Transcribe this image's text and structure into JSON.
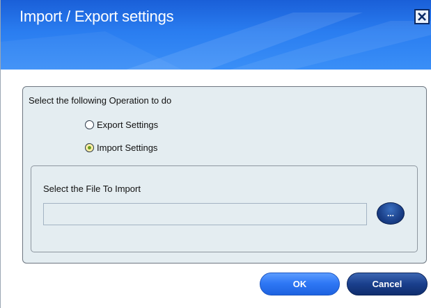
{
  "window": {
    "title": "Import / Export settings",
    "close_icon": "close-x-icon"
  },
  "operation": {
    "prompt": "Select the following Operation to do",
    "options": [
      {
        "label": "Export Settings",
        "selected": false
      },
      {
        "label": "Import Settings",
        "selected": true
      }
    ]
  },
  "file_import": {
    "label": "Select the File To Import",
    "value": "",
    "browse_label": "..."
  },
  "buttons": {
    "ok_label": "OK",
    "cancel_label": "Cancel"
  },
  "colors": {
    "title_bar": "#2a7df0",
    "panel_background": "#e4edf1",
    "ok_button": "#2f78f5",
    "cancel_button": "#1a3f8c",
    "selected_radio_dot": "#6c9c1c"
  }
}
